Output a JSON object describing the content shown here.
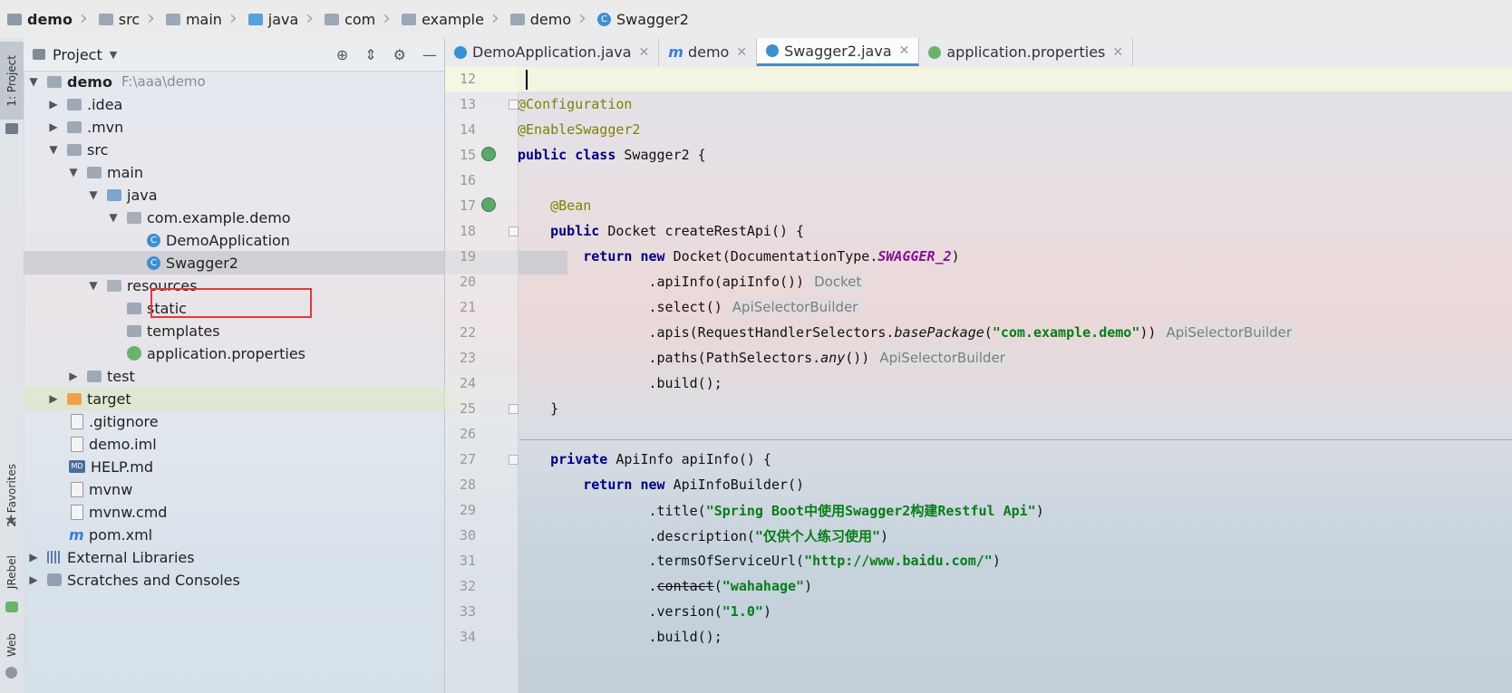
{
  "breadcrumb": [
    {
      "label": "demo",
      "icon": "module-icon",
      "bold": true
    },
    {
      "label": "src",
      "icon": "folder-icon"
    },
    {
      "label": "main",
      "icon": "folder-icon"
    },
    {
      "label": "java",
      "icon": "source-folder-icon"
    },
    {
      "label": "com",
      "icon": "package-icon"
    },
    {
      "label": "example",
      "icon": "package-icon"
    },
    {
      "label": "demo",
      "icon": "package-icon"
    },
    {
      "label": "Swagger2",
      "icon": "class-icon"
    }
  ],
  "tool_strip": {
    "project_tab": "1: Project",
    "favorites_tab": "2: Favorites",
    "jrebel_tab": "JRebel",
    "web_tab": "Web"
  },
  "project_panel": {
    "title": "Project",
    "tree": {
      "root_label": "demo",
      "root_path": "F:\\aaa\\demo",
      "idea": ".idea",
      "mvn": ".mvn",
      "src": "src",
      "main": "main",
      "java": "java",
      "package": "com.example.demo",
      "demo_application": "DemoApplication",
      "swagger2": "Swagger2",
      "resources": "resources",
      "static": "static",
      "templates": "templates",
      "application_properties": "application.properties",
      "test": "test",
      "target": "target",
      "gitignore": ".gitignore",
      "demo_iml": "demo.iml",
      "help_md": "HELP.md",
      "mvnw": "mvnw",
      "mvnw_cmd": "mvnw.cmd",
      "pom_xml": "pom.xml",
      "external_libraries": "External Libraries",
      "scratches": "Scratches and Consoles"
    }
  },
  "editor_tabs": [
    {
      "label": "DemoApplication.java",
      "icon": "spring-class-icon"
    },
    {
      "label": "demo",
      "icon": "maven-icon"
    },
    {
      "label": "Swagger2.java",
      "icon": "class-icon",
      "active": true
    },
    {
      "label": "application.properties",
      "icon": "spring-leaf-icon"
    }
  ],
  "code": {
    "l12": "12",
    "l13": "13",
    "l14": "14",
    "l15": "15",
    "l16": "16",
    "l17": "17",
    "l18": "18",
    "l19": "19",
    "l20": "20",
    "l21": "21",
    "l22": "22",
    "l23": "23",
    "l24": "24",
    "l25": "25",
    "l26": "26",
    "l27": "27",
    "l28": "28",
    "l29": "29",
    "l30": "30",
    "l31": "31",
    "l32": "32",
    "l33": "33",
    "l34": "34",
    "ann_configuration": "@Configuration",
    "ann_enable": "@EnableSwagger2",
    "kw_public": "public",
    "kw_class": "class",
    "class_decl_rest": " Swagger2 {",
    "ann_bean": "@Bean",
    "docket_sig": " Docket createRestApi() {",
    "kw_return": "return",
    "kw_new": "new",
    "docket_call": " Docket(DocumentationType.",
    "swagger_2": "SWAGGER_2",
    "close_paren": ")",
    "apiinfo_call": ".apiInfo(apiInfo())",
    "hint_docket": "Docket",
    "select_call": ".select()",
    "hint_api_selector": "ApiSelectorBuilder",
    "apis_call_a": ".apis(RequestHandlerSelectors.",
    "base_package": "basePackage",
    "apis_open": "(",
    "apis_str": "\"com.example.demo\"",
    "apis_close": "))",
    "paths_call_a": ".paths(PathSelectors.",
    "paths_any": "any",
    "paths_close": "())",
    "build_call": ".build();",
    "close_brace": "}",
    "kw_private": "private",
    "apiinfo_sig": " ApiInfo apiInfo() {",
    "apiinfobuilder": " ApiInfoBuilder()",
    "title_call": ".title(",
    "title_str": "\"Spring Boot中使用Swagger2构建Restful Api\"",
    "description_call": ".description(",
    "description_str": "\"仅供个人练习使用\"",
    "terms_call": ".termsOfServiceUrl(",
    "terms_str": "\"http://www.baidu.com/\"",
    "dot": ".",
    "contact": "contact",
    "contact_str": "\"wahahage\"",
    "version_call": ".version(",
    "version_str": "\"1.0\""
  },
  "colors": {
    "highlight_border": "#e03a3a",
    "annotation": "#808000",
    "keyword": "#000080",
    "string": "#067d17",
    "constant": "#871094"
  }
}
